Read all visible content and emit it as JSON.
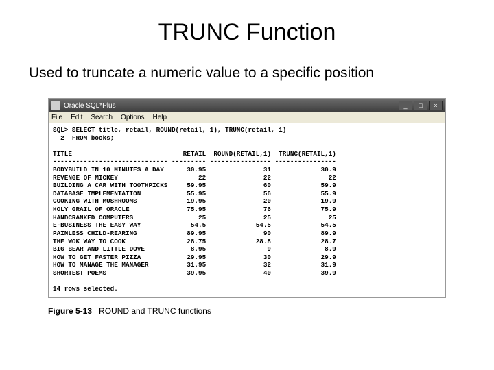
{
  "heading": "TRUNC Function",
  "subheading": "Used to truncate a numeric value to a specific position",
  "window": {
    "title": "Oracle SQL*Plus",
    "menu": [
      "File",
      "Edit",
      "Search",
      "Options",
      "Help"
    ],
    "min": "_",
    "max": "□",
    "close": "×"
  },
  "sql": {
    "line1": "SQL> SELECT title, retail, ROUND(retail, 1), TRUNC(retail, 1)",
    "line2": "  2  FROM books;"
  },
  "columns": {
    "c1": "TITLE",
    "c2": "RETAIL",
    "c3": "ROUND(RETAIL,1)",
    "c4": "TRUNC(RETAIL,1)"
  },
  "rows": [
    {
      "t": "BODYBUILD IN 10 MINUTES A DAY",
      "r": "30.95",
      "ro": "31",
      "tr": "30.9"
    },
    {
      "t": "REVENGE OF MICKEY",
      "r": "22",
      "ro": "22",
      "tr": "22"
    },
    {
      "t": "BUILDING A CAR WITH TOOTHPICKS",
      "r": "59.95",
      "ro": "60",
      "tr": "59.9"
    },
    {
      "t": "DATABASE IMPLEMENTATION",
      "r": "55.95",
      "ro": "56",
      "tr": "55.9"
    },
    {
      "t": "COOKING WITH MUSHROOMS",
      "r": "19.95",
      "ro": "20",
      "tr": "19.9"
    },
    {
      "t": "HOLY GRAIL OF ORACLE",
      "r": "75.95",
      "ro": "76",
      "tr": "75.9"
    },
    {
      "t": "HANDCRANKED COMPUTERS",
      "r": "25",
      "ro": "25",
      "tr": "25"
    },
    {
      "t": "E-BUSINESS THE EASY WAY",
      "r": "54.5",
      "ro": "54.5",
      "tr": "54.5"
    },
    {
      "t": "PAINLESS CHILD-REARING",
      "r": "89.95",
      "ro": "90",
      "tr": "89.9"
    },
    {
      "t": "THE WOK WAY TO COOK",
      "r": "28.75",
      "ro": "28.8",
      "tr": "28.7"
    },
    {
      "t": "BIG BEAR AND LITTLE DOVE",
      "r": "8.95",
      "ro": "9",
      "tr": "8.9"
    },
    {
      "t": "HOW TO GET FASTER PIZZA",
      "r": "29.95",
      "ro": "30",
      "tr": "29.9"
    },
    {
      "t": "HOW TO MANAGE THE MANAGER",
      "r": "31.95",
      "ro": "32",
      "tr": "31.9"
    },
    {
      "t": "SHORTEST POEMS",
      "r": "39.95",
      "ro": "40",
      "tr": "39.9"
    }
  ],
  "summary": "14 rows selected.",
  "figure": {
    "num": "Figure 5-13",
    "cap": "ROUND and TRUNC functions"
  }
}
